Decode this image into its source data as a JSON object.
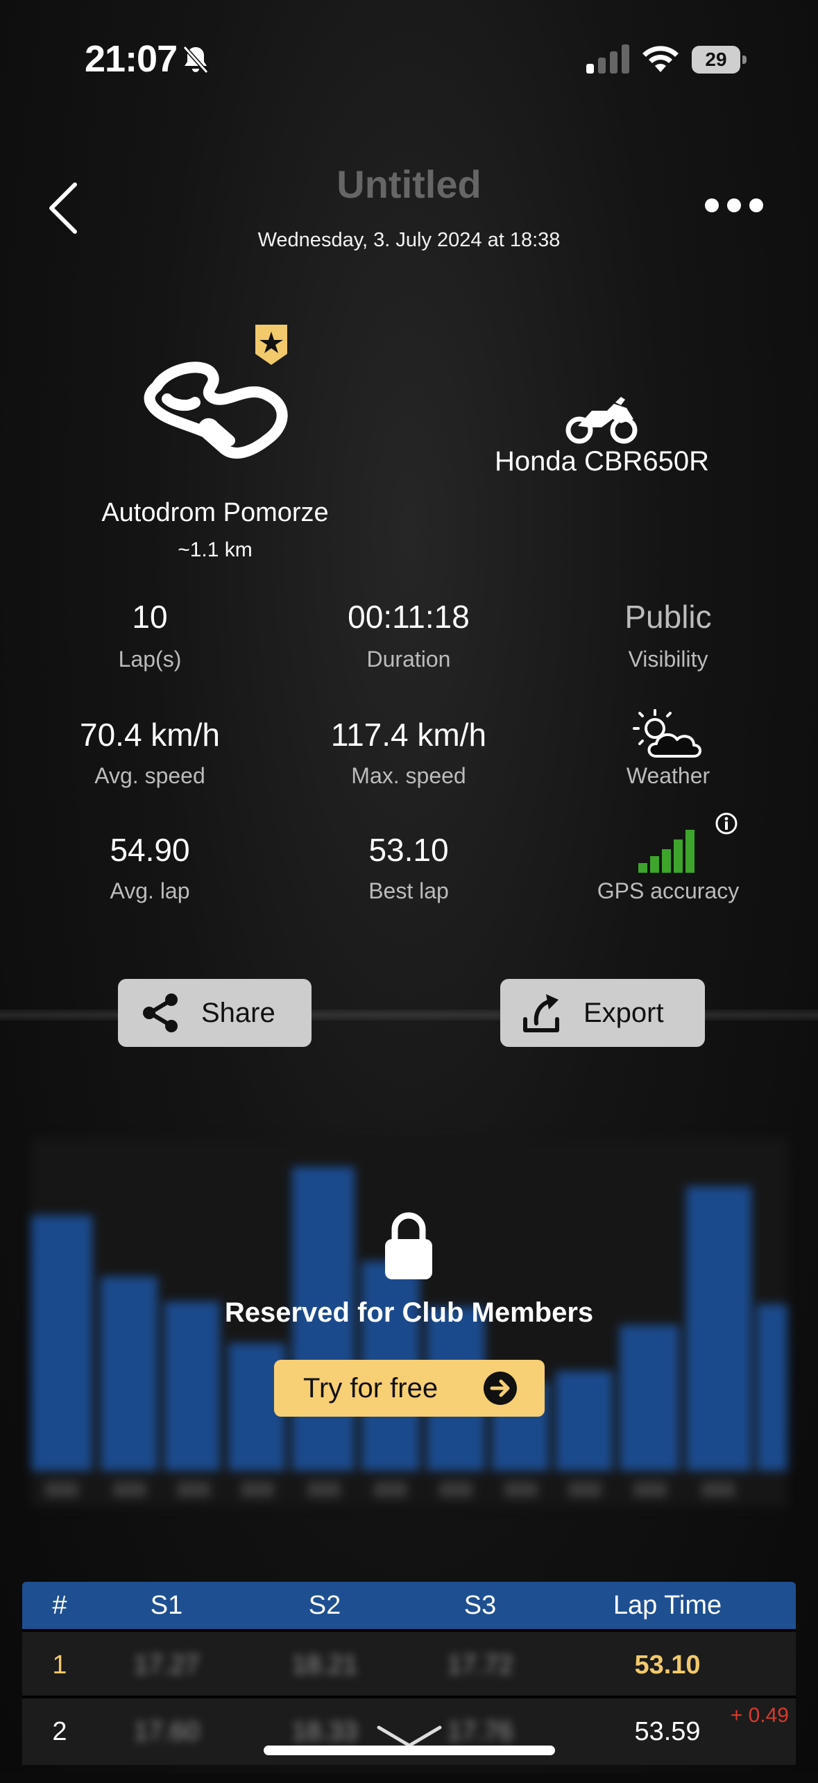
{
  "status_bar": {
    "time": "21:07",
    "battery": "29"
  },
  "header": {
    "title": "Untitled",
    "datetime": "Wednesday, 3. July 2024 at 18:38"
  },
  "track": {
    "name": "Autodrom Pomorze",
    "length": "~1.1 km"
  },
  "bike": {
    "name": "Honda CBR650R"
  },
  "stats": [
    {
      "value": "10",
      "label": "Lap(s)"
    },
    {
      "value": "00:11:18",
      "label": "Duration"
    },
    {
      "value": "Public",
      "label": "Visibility"
    },
    {
      "value": "70.4 km/h",
      "label": "Avg. speed"
    },
    {
      "value": "117.4 km/h",
      "label": "Max. speed"
    },
    {
      "value": "",
      "label": "Weather"
    },
    {
      "value": "54.90",
      "label": "Avg. lap"
    },
    {
      "value": "53.10",
      "label": "Best lap"
    },
    {
      "value": "",
      "label": "GPS accuracy"
    }
  ],
  "actions": {
    "share": "Share",
    "export": "Export"
  },
  "locked": {
    "message": "Reserved for Club Members",
    "cta": "Try for free"
  },
  "icons": {
    "back": "chevron-left-icon",
    "more": "more-horizontal-icon",
    "badge": "star-badge-icon",
    "weather": "partly-cloudy-icon",
    "gps": "signal-bars-icon",
    "lock": "lock-icon"
  },
  "colors": {
    "accent_gold": "#f7cf74",
    "table_header": "#1e4f91",
    "delta_red": "#d93a2c",
    "gps_green": "#3da52c"
  },
  "laps_table": {
    "headers": [
      "#",
      "S1",
      "S2",
      "S3",
      "Lap Time"
    ],
    "rows": [
      {
        "num": "1",
        "s1": "17.27",
        "s2": "18.21",
        "s3": "17.72",
        "lap": "53.10",
        "delta": ""
      },
      {
        "num": "2",
        "s1": "17.60",
        "s2": "18.33",
        "s3": "17.76",
        "lap": "53.59",
        "delta": "+ 0.49"
      }
    ]
  }
}
